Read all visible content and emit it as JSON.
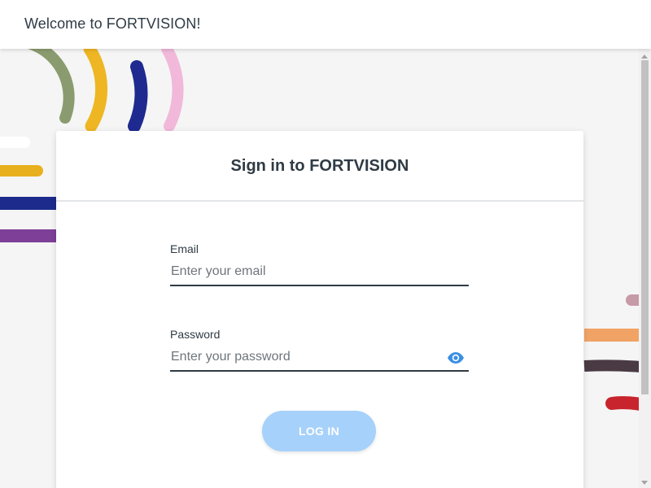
{
  "header": {
    "title": "Welcome to FORTVISION!"
  },
  "login": {
    "title": "Sign in to FORTVISION",
    "email": {
      "label": "Email",
      "placeholder": "Enter your email",
      "value": ""
    },
    "password": {
      "label": "Password",
      "placeholder": "Enter your password",
      "value": "",
      "toggle_icon": "eye-icon"
    },
    "button_label": "LOG IN"
  },
  "colors": {
    "page_background": "#f5f5f5",
    "header_background": "#ffffff",
    "text": "#2f3b45",
    "button_background": "#a6d1fb",
    "button_text": "#ffffff",
    "eye_icon": "#3b8fe6",
    "input_underline": "#2f3b45"
  }
}
